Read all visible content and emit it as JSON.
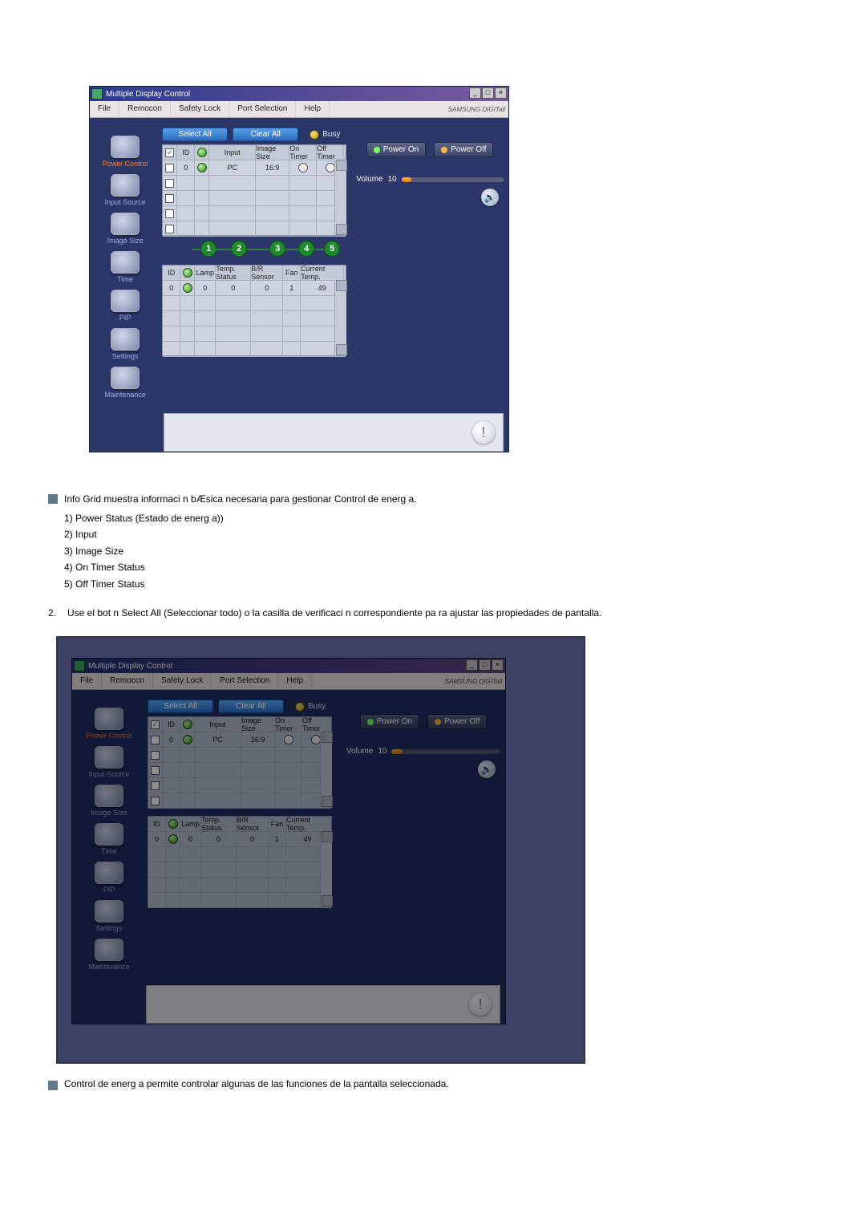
{
  "win": {
    "title": "Multiple Display Control",
    "menus": [
      "File",
      "Remocon",
      "Safety Lock",
      "Port Selection",
      "Help"
    ],
    "brand": "SAMSUNG DIGITall"
  },
  "sidebar": {
    "items": [
      {
        "label": "Power Control",
        "active": true
      },
      {
        "label": "Input Source"
      },
      {
        "label": "Image Size"
      },
      {
        "label": "Time"
      },
      {
        "label": "PIP"
      },
      {
        "label": "Settings"
      },
      {
        "label": "Maintenance"
      }
    ]
  },
  "toolbar": {
    "select_all": "Select All",
    "clear_all": "Clear All",
    "busy": "Busy"
  },
  "grid1": {
    "headers": {
      "chk": "",
      "id": "ID",
      "pwr": "",
      "input": "Input",
      "imgsz": "Image Size",
      "on": "On Timer",
      "off": "Off Timer"
    },
    "rows": [
      {
        "checked": true,
        "id": "0",
        "input": "PC",
        "imgsz": "16:9"
      },
      {
        "checked": false,
        "id": "",
        "input": "",
        "imgsz": ""
      },
      {
        "checked": false,
        "id": "",
        "input": "",
        "imgsz": ""
      },
      {
        "checked": false,
        "id": "",
        "input": "",
        "imgsz": ""
      },
      {
        "checked": false,
        "id": "",
        "input": "",
        "imgsz": ""
      }
    ]
  },
  "callouts": [
    "1",
    "2",
    "3",
    "4",
    "5"
  ],
  "grid2": {
    "headers": {
      "id": "ID",
      "pwr": "",
      "lamp": "Lamp",
      "ts": "Temp. Status",
      "bs": "B/R Sensor",
      "fan": "Fan",
      "ct": "Current Temp."
    },
    "rows": [
      {
        "id": "0",
        "lamp": "0",
        "ts": "0",
        "bs": "0",
        "fan": "1",
        "ct": "49"
      },
      {
        "id": "",
        "lamp": "",
        "ts": "",
        "bs": "",
        "fan": "",
        "ct": ""
      },
      {
        "id": "",
        "lamp": "",
        "ts": "",
        "bs": "",
        "fan": "",
        "ct": ""
      },
      {
        "id": "",
        "lamp": "",
        "ts": "",
        "bs": "",
        "fan": "",
        "ct": ""
      },
      {
        "id": "",
        "lamp": "",
        "ts": "",
        "bs": "",
        "fan": "",
        "ct": ""
      }
    ]
  },
  "power": {
    "on": "Power On",
    "off": "Power Off",
    "volume_label": "Volume",
    "volume_value": "10"
  },
  "text": {
    "line1": "Info Grid muestra informaci n bÆsica necesaria para gestionar Control de energ a.",
    "sub": [
      "1)    Power Status (Estado de energ a))",
      "2) Input",
      "3) Image Size",
      "4) On Timer Status",
      "5) Off Timer Status"
    ],
    "para2_num": "2.",
    "para2": "Use el bot n Select All (Seleccionar todo) o la casilla de verificaci n correspondiente pa ra ajustar las propiedades de pantalla.",
    "final": "Control de energ a permite controlar algunas de las funciones de la pantalla seleccionada."
  },
  "dark": {
    "busy": "Busy"
  }
}
